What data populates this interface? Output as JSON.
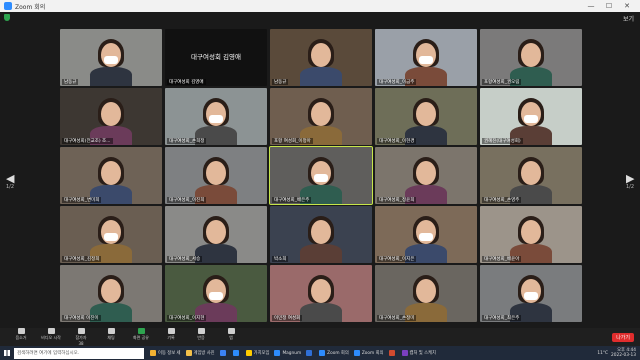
{
  "window": {
    "title": "Zoom 회의",
    "minimize": "—",
    "maximize": "☐",
    "close": "✕"
  },
  "view_label": "보기",
  "pager": {
    "left_page": "1/2",
    "right_page": "1/2"
  },
  "tiles": [
    {
      "name": "남동규",
      "bg": "#8a8b88"
    },
    {
      "name": "대구여성회 김영애",
      "bg": "#111111",
      "text": "대구여성회 김영애"
    },
    {
      "name": "남동규",
      "bg": "#5a4a3a"
    },
    {
      "name": "대구여성회_이금주",
      "bg": "#9aa0a8"
    },
    {
      "name": "포항여성회_권오림",
      "bg": "#7b7a7a"
    },
    {
      "name": "대구여성회(전교조) 조...",
      "bg": "#3d3732"
    },
    {
      "name": "대구여성회_손희정",
      "bg": "#8c9394"
    },
    {
      "name": "포항 여성회_이정아",
      "bg": "#6f5e4f"
    },
    {
      "name": "대구여성회_이현경",
      "bg": "#6e6e58"
    },
    {
      "name": "권혜진(대구여성회)",
      "bg": "#c6cec8"
    },
    {
      "name": "대구여성회_변미희",
      "bg": "#6e6256"
    },
    {
      "name": "대구여성회_이진희",
      "bg": "#7e8082"
    },
    {
      "name": "대구여성회_배은주",
      "bg": "#5f5e5c",
      "active": true
    },
    {
      "name": "대구여성회_정윤희",
      "bg": "#7c756c"
    },
    {
      "name": "대구여성회_손영주",
      "bg": "#78705f"
    },
    {
      "name": "대구여성회_김정희",
      "bg": "#6a5e52"
    },
    {
      "name": "대구여성회_서승",
      "bg": "#8a8a88"
    },
    {
      "name": "박소희",
      "bg": "#3b4250"
    },
    {
      "name": "대구여성회_이지은",
      "bg": "#7d6a58"
    },
    {
      "name": "대구여성회_배윤아",
      "bg": "#9c948a"
    },
    {
      "name": "대구여성회 이진이",
      "bg": "#7c7873"
    },
    {
      "name": "대구여성회_이지현",
      "bg": "#4a5a40"
    },
    {
      "name": "이민정 여성회",
      "bg": "#9a6a6a"
    },
    {
      "name": "대구여성회_손정미",
      "bg": "#6a6660"
    },
    {
      "name": "대구여성회_최은주",
      "bg": "#7a7c7e"
    }
  ],
  "toolbar": {
    "items": [
      {
        "label": "음소거",
        "icon": "mic-icon"
      },
      {
        "label": "비디오 시작",
        "icon": "video-icon"
      },
      {
        "label": "참가자",
        "icon": "participants-icon",
        "count": "38"
      },
      {
        "label": "채팅",
        "icon": "chat-icon"
      },
      {
        "label": "화면 공유",
        "icon": "share-screen-icon"
      },
      {
        "label": "기록",
        "icon": "record-icon"
      },
      {
        "label": "반응",
        "icon": "reactions-icon"
      },
      {
        "label": "앱",
        "icon": "apps-icon"
      }
    ],
    "leave_label": "나가기"
  },
  "taskbar": {
    "search_placeholder": "검색하려면 여기에 입력하십시오.",
    "apps": [
      {
        "label": "이동 정보 세",
        "color": "#f2b233"
      },
      {
        "label": "게임방 사진",
        "color": "#f2c04a"
      },
      {
        "label": "",
        "color": "#3b82f6"
      },
      {
        "label": "",
        "color": "#2d8cff"
      },
      {
        "label": "가치모임",
        "color": "#ffcc00"
      },
      {
        "label": "Magnum",
        "color": "#2d8cff"
      },
      {
        "label": "",
        "color": "#2f6fd6"
      },
      {
        "label": "Zoom 회의",
        "color": "#2d8cff"
      },
      {
        "label": "Zoom 회의",
        "color": "#2d8cff"
      },
      {
        "label": "",
        "color": "#d04a2f"
      },
      {
        "label": "캡처 및 스케치",
        "color": "#7a3fc0"
      }
    ],
    "weather": "11°C",
    "time": "오후 4:44",
    "date": "2022-03-13"
  }
}
